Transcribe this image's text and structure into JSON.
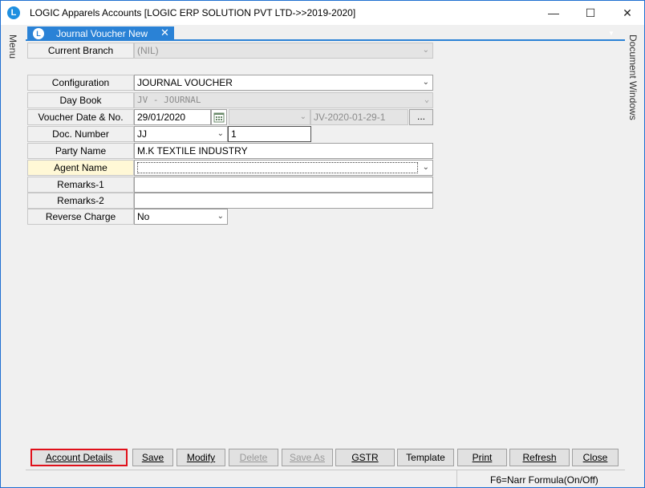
{
  "window": {
    "app_icon": "L",
    "title": "LOGIC Apparels Accounts  [LOGIC ERP SOLUTION PVT LTD->>2019-2020]",
    "minimize_glyph": "—",
    "maximize_glyph": "☐",
    "close_glyph": "✕"
  },
  "rails": {
    "menu": "Menu",
    "document_windows": "Document Windows"
  },
  "tab": {
    "icon": "L",
    "label": "Journal Voucher New",
    "close_glyph": "✕"
  },
  "form": {
    "current_branch": {
      "label": "Current Branch",
      "value": "(NIL)"
    },
    "configuration": {
      "label": "Configuration",
      "value": "JOURNAL VOUCHER"
    },
    "day_book": {
      "label": "Day Book",
      "value": "JV - JOURNAL"
    },
    "voucher_date_no": {
      "label": "Voucher Date & No.",
      "date": "29/01/2020",
      "voucher_number": "JV-2020-01-29-1",
      "ellipsis": "..."
    },
    "doc_number": {
      "label": "Doc. Number",
      "series": "JJ",
      "number": "1"
    },
    "party_name": {
      "label": "Party Name",
      "value": "M.K TEXTILE INDUSTRY"
    },
    "agent_name": {
      "label": "Agent Name",
      "value": ""
    },
    "remarks_1": {
      "label": "Remarks-1",
      "value": ""
    },
    "remarks_2": {
      "label": "Remarks-2",
      "value": ""
    },
    "reverse_charge": {
      "label": "Reverse Charge",
      "value": "No"
    }
  },
  "icons": {
    "dropdown": "chevron-down-icon",
    "calendar": "calendar-icon"
  },
  "buttons": {
    "account_details": "Account Details",
    "save": "Save",
    "modify": "Modify",
    "delete": "Delete",
    "save_as": "Save As",
    "gstr": "GSTR",
    "template": "Template",
    "print": "Print",
    "refresh": "Refresh",
    "close": "Close"
  },
  "status": {
    "hint": "F6=Narr Formula(On/Off)"
  },
  "colors": {
    "accent": "#2a82d6",
    "focus_border": "#e0101a",
    "highlight_row": "#fff8d6"
  }
}
